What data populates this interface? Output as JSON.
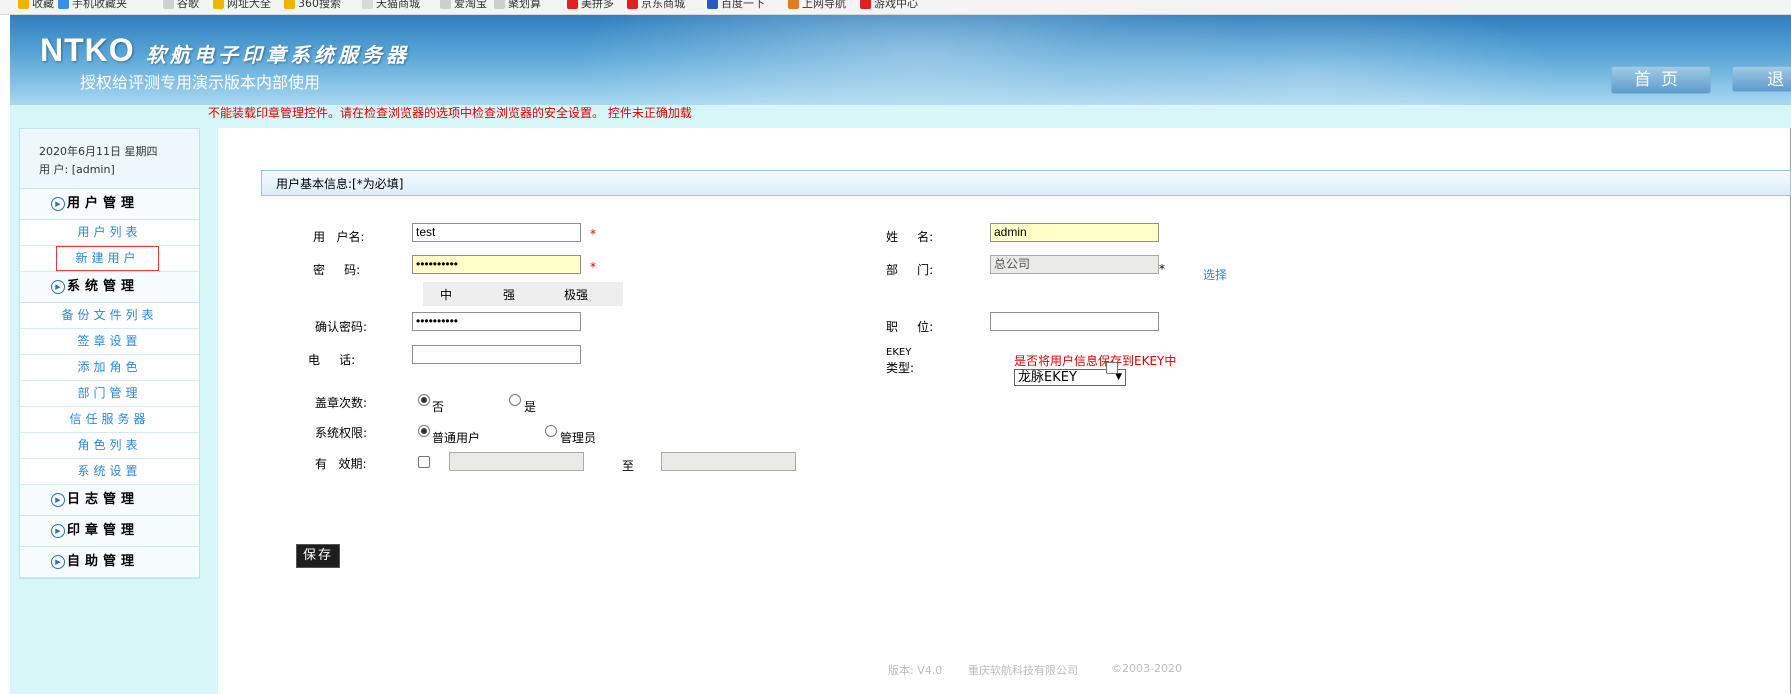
{
  "bookmarks": [
    {
      "label": "收藏",
      "color": "#f2b300"
    },
    {
      "label": "手机收藏夹",
      "color": "#3a8ee6"
    },
    {
      "label": "谷歌",
      "color": "#cfcfcf"
    },
    {
      "label": "网址大全",
      "color": "#f2b300"
    },
    {
      "label": "360搜索",
      "color": "#f2b300"
    },
    {
      "label": "天猫商城",
      "color": "#d8d8d8"
    },
    {
      "label": "爱淘宝",
      "color": "#cfcfcf"
    },
    {
      "label": "聚划算",
      "color": "#cfcfcf"
    },
    {
      "label": "美拼多",
      "color": "#e02020"
    },
    {
      "label": "京东商城",
      "color": "#e02020"
    },
    {
      "label": "百度一下",
      "color": "#2a56c6"
    },
    {
      "label": "上网导航",
      "color": "#e07b20"
    },
    {
      "label": "游戏中心",
      "color": "#e02020"
    }
  ],
  "header": {
    "brand": "NTKO",
    "brand_sub": "软航电子印章系统服务器",
    "tagline": "授权给评测专用演示版本内部使用",
    "home_label": "首页",
    "logout_label": "退"
  },
  "warning": "不能装载印章管理控件。请在检查浏览器的选项中检查浏览器的安全设置。 控件未正确加载",
  "sidebar": {
    "date_line": "2020年6月11日 星期四",
    "user_line": "用  户: [admin]",
    "groups": [
      {
        "title": "用户管理",
        "items": [
          "用户列表",
          "新建用户"
        ]
      },
      {
        "title": "系统管理",
        "items": [
          "备份文件列表",
          "签章设置",
          "添加角色",
          "部门管理",
          "信任服务器",
          "角色列表",
          "系统设置"
        ]
      },
      {
        "title": "日志管理",
        "items": []
      },
      {
        "title": "印章管理",
        "items": []
      },
      {
        "title": "自助管理",
        "items": []
      }
    ]
  },
  "form": {
    "section_title": "用户基本信息:[*为必填]",
    "username_label": "用   户名:",
    "username_value": "test",
    "password_label": "密     码:",
    "password_value": "••••••••••",
    "strength": [
      "中",
      "强",
      "极强"
    ],
    "confirm_label": "确认密码:",
    "confirm_value": "••••••••••",
    "phone_label": "电     话:",
    "phone_value": "",
    "stamp_count_label": "盖章次数:",
    "stamp_no": "否",
    "stamp_yes": "是",
    "perm_label": "系统权限:",
    "perm_normal": "普通用户",
    "perm_admin": "管理员",
    "valid_label": "有   效期:",
    "valid_to": "至",
    "required_mark": "*",
    "name_label": "姓     名:",
    "name_value": "admin",
    "dept_label": "部     门:",
    "dept_value": "总公司",
    "dept_pick": "选择",
    "position_label": "职     位:",
    "position_value": "",
    "ekey_label_1": "EKEY",
    "ekey_label_2": "类型:",
    "ekey_note": "是否将用户信息保存到EKEY中",
    "ekey_type": "龙脉EKEY",
    "save_label": "保存"
  },
  "footer": {
    "version": "版本: V4.0",
    "company": "重庆软航科技有限公司",
    "copyright": "©2003-2020"
  }
}
